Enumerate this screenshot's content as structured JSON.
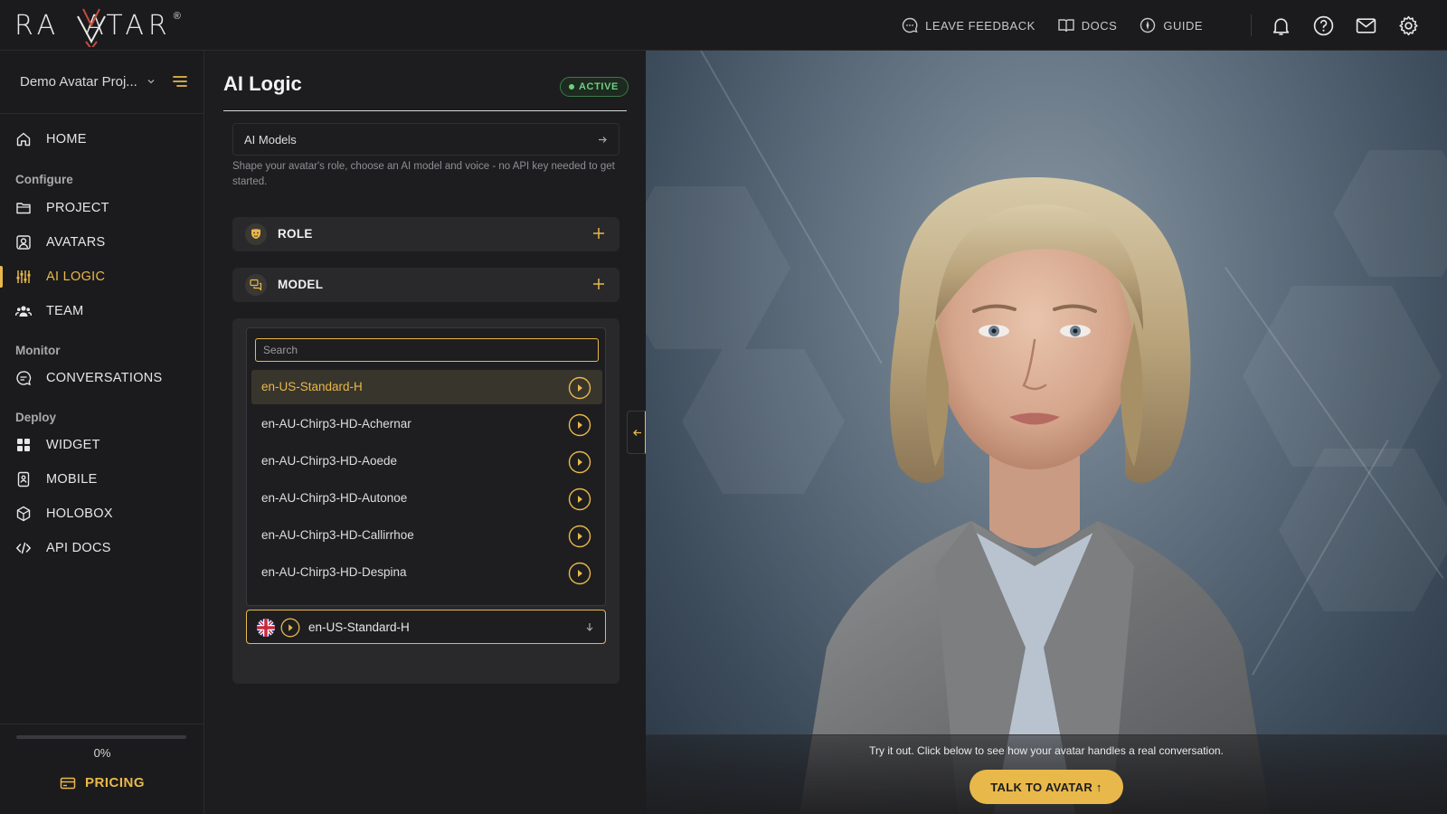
{
  "brand": {
    "name": "RAVATAR",
    "registered": "®"
  },
  "topbar": {
    "links": [
      {
        "label": "LEAVE FEEDBACK",
        "icon": "feedback-icon"
      },
      {
        "label": "DOCS",
        "icon": "book-icon"
      },
      {
        "label": "GUIDE",
        "icon": "compass-icon"
      }
    ],
    "icons": [
      "bell-icon",
      "help-icon",
      "mail-icon",
      "gear-icon"
    ]
  },
  "sidebar": {
    "project": "Demo Avatar Proj...",
    "home": "HOME",
    "sections": {
      "configure": "Configure",
      "monitor": "Monitor",
      "deploy": "Deploy"
    },
    "configure_items": [
      "PROJECT",
      "AVATARS",
      "AI LOGIC",
      "TEAM"
    ],
    "monitor_items": [
      "CONVERSATIONS"
    ],
    "deploy_items": [
      "WIDGET",
      "MOBILE",
      "HOLOBOX",
      "API DOCS"
    ],
    "active_item": "AI LOGIC",
    "progress": {
      "label": "0%",
      "value": 0
    },
    "pricing": "PRICING"
  },
  "main": {
    "title": "AI Logic",
    "status": "ACTIVE",
    "models_link": "AI Models",
    "description": "Shape your avatar's role, choose an AI model and voice - no API key needed to get started.",
    "sections": {
      "role": "ROLE",
      "model": "MODEL"
    },
    "voice": {
      "search_placeholder": "Search",
      "options": [
        "en-US-Standard-H",
        "en-AU-Chirp3-HD-Achernar",
        "en-AU-Chirp3-HD-Aoede",
        "en-AU-Chirp3-HD-Autonoe",
        "en-AU-Chirp3-HD-Callirrhoe",
        "en-AU-Chirp3-HD-Despina"
      ],
      "selected": "en-US-Standard-H"
    }
  },
  "preview": {
    "hint": "Try it out. Click below to see how your avatar handles a real conversation.",
    "talk_button": "TALK TO AVATAR ↑"
  },
  "colors": {
    "accent": "#e8b84a",
    "active_green": "#6fcf7f",
    "background": "#1b1b1d"
  }
}
